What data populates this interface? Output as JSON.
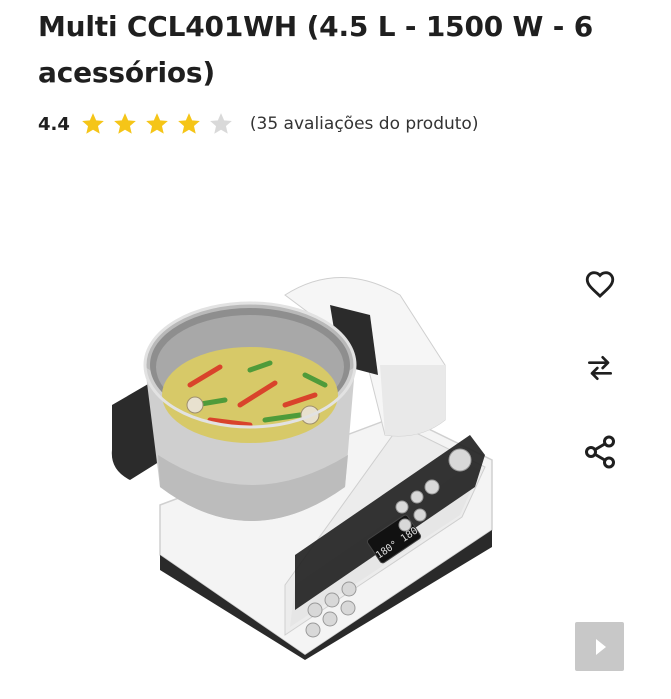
{
  "product": {
    "title": "Multi CCL401WH (4.5 L - 1500 W - 6 acessórios)",
    "rating_value": "4.4",
    "rating": 4.4,
    "rating_max": 5,
    "review_count_text": "(35 avaliações do produto)"
  },
  "colors": {
    "star_filled": "#f5c518",
    "star_empty": "#d9d9d9",
    "text": "#1f1f1f",
    "nav_button": "#c8c8c8"
  },
  "actions": {
    "wishlist_icon": "heart-icon",
    "compare_icon": "compare-arrows-icon",
    "share_icon": "share-icon",
    "next_icon": "chevron-right-icon"
  }
}
